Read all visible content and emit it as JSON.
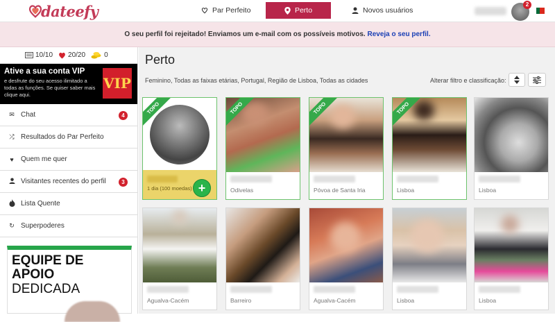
{
  "header": {
    "logo_text": "dateefy",
    "nav": [
      {
        "label": "Par Perfeito",
        "icon": "heart-outline-icon"
      },
      {
        "label": "Perto",
        "icon": "map-pin-icon",
        "active": true
      },
      {
        "label": "Novos usuários",
        "icon": "user-icon"
      }
    ],
    "notifications_count": "2"
  },
  "banner": {
    "text": "O seu perfil foi rejeitado! Enviamos um e-mail com os possíveis motivos.",
    "link": "Reveja o seu perfil."
  },
  "sidebar": {
    "credits": [
      {
        "icon": "message-credit-icon",
        "value": "10/10"
      },
      {
        "icon": "heart-icon",
        "value": "20/20"
      },
      {
        "icon": "coins-icon",
        "value": "0"
      }
    ],
    "vip": {
      "title": "Ative a sua conta VIP",
      "description": "e desfrute do seu acesso ilimitado a todas as funções. Se quiser saber mais clique aqui.",
      "badge": "VIP"
    },
    "menu": [
      {
        "label": "Chat",
        "icon": "envelope-icon",
        "count": "4"
      },
      {
        "label": "Resultados do Par Perfeito",
        "icon": "shuffle-icon",
        "count": ""
      },
      {
        "label": "Quem me quer",
        "icon": "heart-icon",
        "count": ""
      },
      {
        "label": "Visitantes recentes do perfil",
        "icon": "user-icon",
        "count": "3"
      },
      {
        "label": "Lista Quente",
        "icon": "fire-icon",
        "count": ""
      },
      {
        "label": "Superpoderes",
        "icon": "refresh-icon",
        "count": ""
      }
    ],
    "support": {
      "line1": "EQUIPE DE",
      "line2": "APOIO",
      "line3": "DEDICADA"
    }
  },
  "main": {
    "title": "Perto",
    "filter_text": "Feminino, Todas as faixas etárias, Portugal, Região de Lisboa, Todas as cidades",
    "alter_label": "Alterar filtro e classificação:",
    "ribbon_label": "TOPO",
    "card0_subtitle": "1 dia (100 moedas)",
    "cards": [
      {
        "city": "",
        "top": true
      },
      {
        "city": "Odivelas",
        "top": true
      },
      {
        "city": "Póvoa de Santa Iria",
        "top": true
      },
      {
        "city": "Lisboa",
        "top": true
      },
      {
        "city": "Lisboa",
        "top": false
      },
      {
        "city": "Agualva-Cacém",
        "top": false
      },
      {
        "city": "Barreiro",
        "top": false
      },
      {
        "city": "Agualva-Cacém",
        "top": false
      },
      {
        "city": "Lisboa",
        "top": false
      },
      {
        "city": "Lisboa",
        "top": false
      }
    ]
  }
}
